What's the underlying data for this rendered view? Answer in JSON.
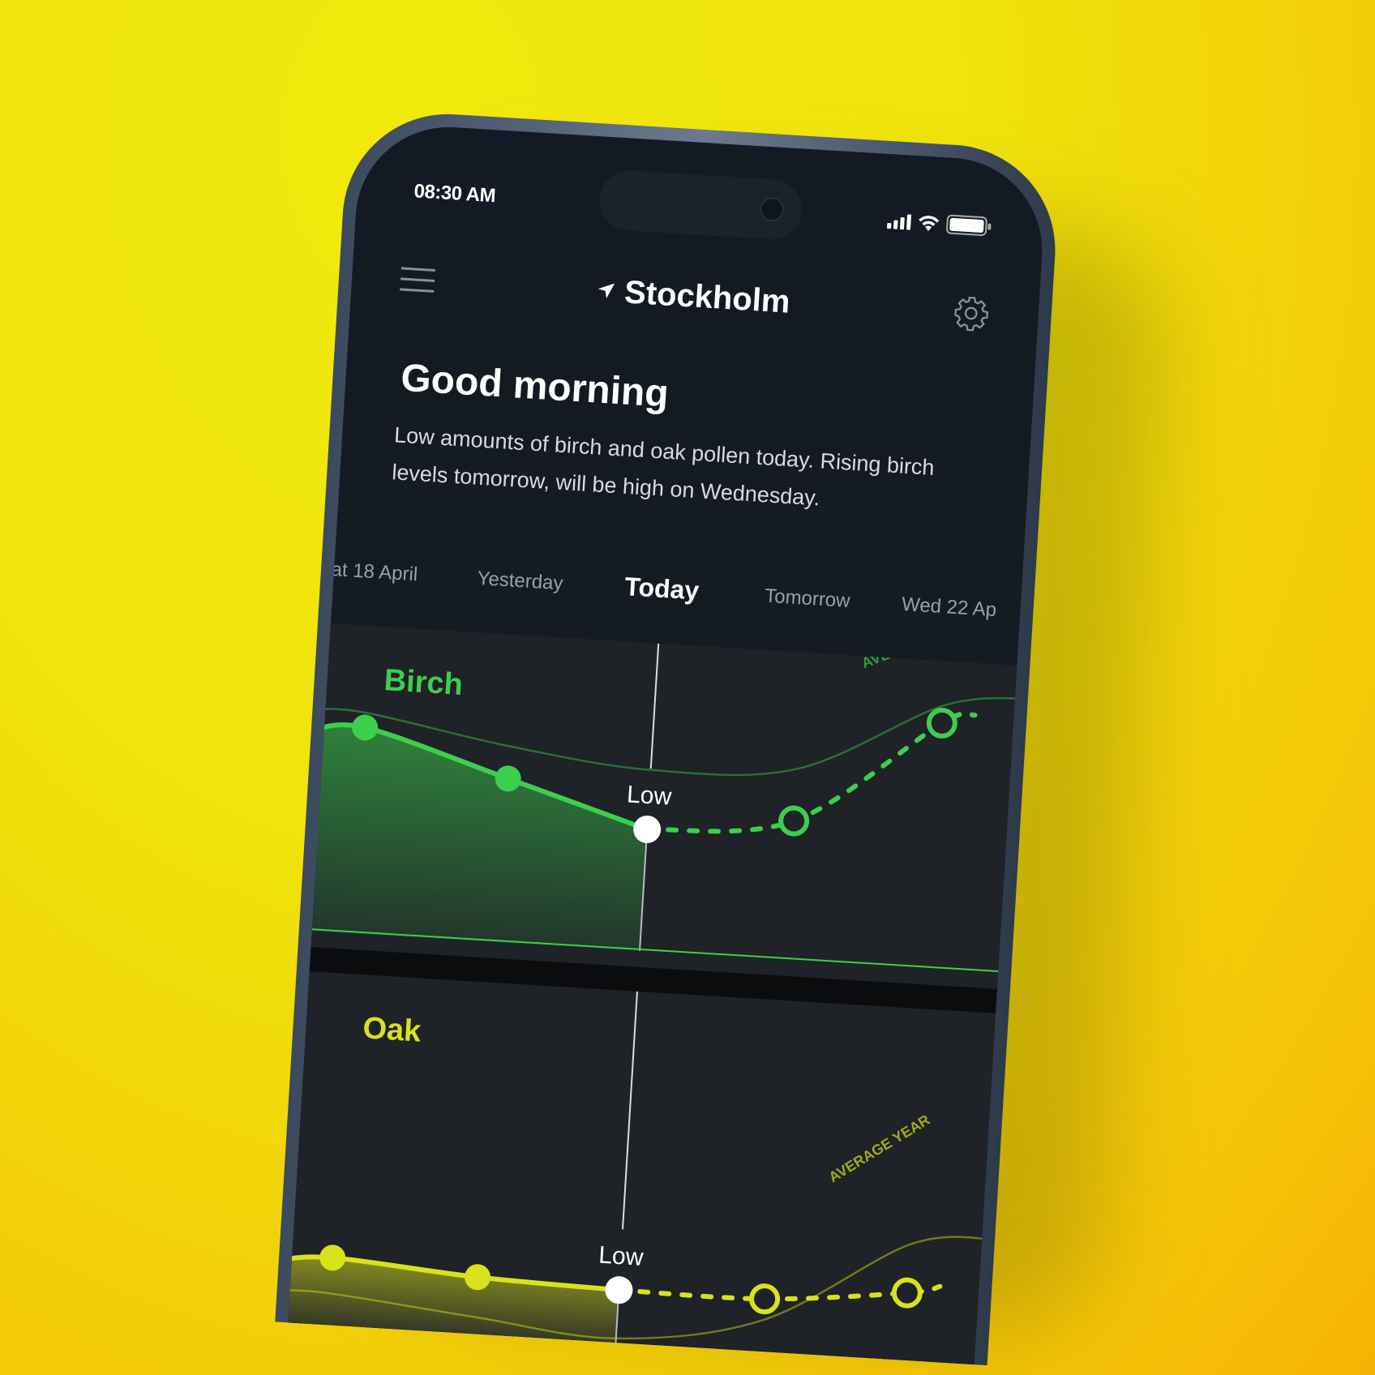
{
  "status_bar": {
    "time": "08:30 AM",
    "icons": [
      "signal-icon",
      "wifi-icon",
      "battery-icon"
    ]
  },
  "header": {
    "location": "Stockholm",
    "location_icon": "location-arrow-icon",
    "menu_icon": "hamburger-menu-icon",
    "settings_icon": "gear-icon"
  },
  "greeting": {
    "title": "Good morning",
    "description": "Low amounts of birch and oak pollen today. Rising birch levels tomorrow, will be high on Wednesday."
  },
  "tabs": [
    {
      "label": "at 18 April"
    },
    {
      "label": "Yesterday"
    },
    {
      "label": "Today",
      "active": true
    },
    {
      "label": "Tomorrow"
    },
    {
      "label": "Wed 22 Ap"
    }
  ],
  "colors": {
    "birch": "#3ccf4e",
    "oak": "#d9e21a",
    "background": "#f1e60c",
    "screen": "#131a23"
  },
  "chart_data": [
    {
      "type": "line",
      "name": "Birch",
      "color": "#3ccf4e",
      "average_label": "AVERAGE YEAR",
      "today_label": "Low",
      "x": [
        "at 18 April",
        "Yesterday",
        "Today",
        "Tomorrow",
        "Wed 22 Ap"
      ],
      "observed": [
        0.72,
        0.55,
        0.38
      ],
      "forecast": [
        0.38,
        0.45,
        0.88
      ],
      "average": [
        0.78,
        0.68,
        0.62,
        0.66,
        0.95
      ]
    },
    {
      "type": "line",
      "name": "Oak",
      "color": "#d9e21a",
      "average_label": "AVERAGE YEAR",
      "today_label": "Low",
      "x": [
        "at 18 April",
        "Yesterday",
        "Today",
        "Tomorrow",
        "Wed 22 Ap"
      ],
      "observed": [
        0.42,
        0.37,
        0.35
      ],
      "forecast": [
        0.35,
        0.35,
        0.42
      ],
      "average": [
        0.25,
        0.18,
        0.12,
        0.25,
        0.65
      ]
    }
  ]
}
